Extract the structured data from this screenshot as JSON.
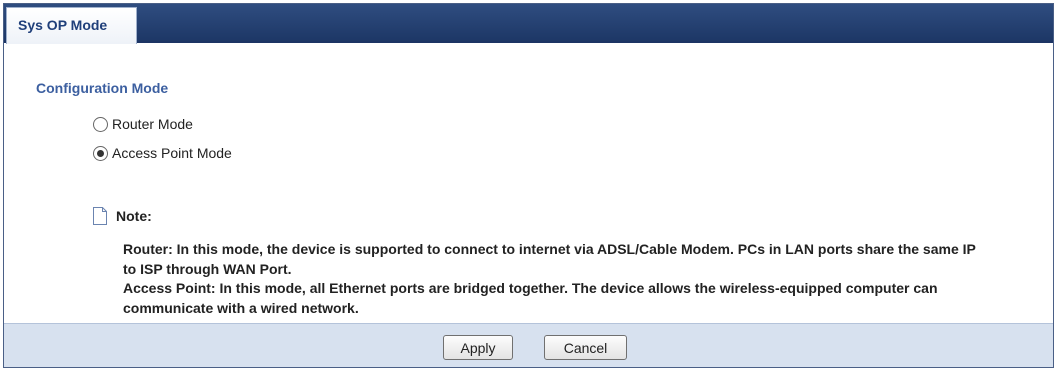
{
  "tab": {
    "label": "Sys OP Mode"
  },
  "section": {
    "title": "Configuration Mode"
  },
  "options": [
    {
      "label": "Router Mode",
      "checked": false
    },
    {
      "label": "Access Point Mode",
      "checked": true
    }
  ],
  "note": {
    "label": "Note:",
    "router": "Router: In this mode, the device is supported to connect to internet via ADSL/Cable Modem. PCs in LAN ports share the same IP to ISP through WAN Port.",
    "access_point": "Access Point: In this mode, all Ethernet ports are bridged together. The device allows the wireless-equipped computer can communicate with a wired network."
  },
  "buttons": {
    "apply": "Apply",
    "cancel": "Cancel"
  }
}
